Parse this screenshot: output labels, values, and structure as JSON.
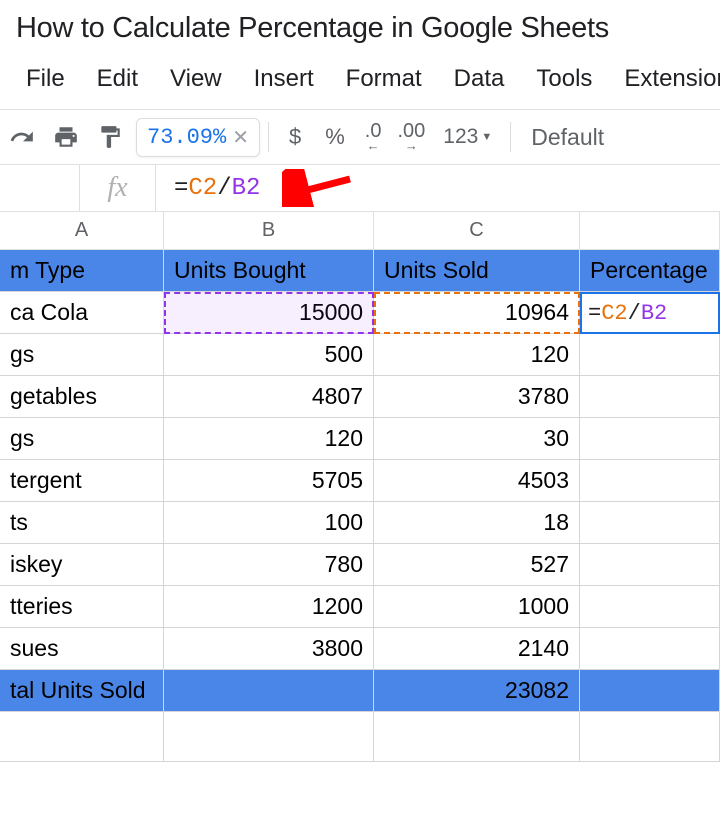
{
  "title": "How to Calculate Percentage in Google Sheets",
  "menu": {
    "file": "File",
    "edit": "Edit",
    "view": "View",
    "insert": "Insert",
    "format": "Format",
    "data": "Data",
    "tools": "Tools",
    "extensions": "Extensions"
  },
  "toolbar": {
    "result_preview": "73.09%",
    "currency": "$",
    "percent": "%",
    "dec_decrease": ".0",
    "dec_increase": ".00",
    "more_formats": "123",
    "font": "Default"
  },
  "formula_bar": {
    "fx": "fx",
    "eq": "=",
    "ref1": "C2",
    "slash": "/",
    "ref2": "B2"
  },
  "columns": {
    "A": "A",
    "B": "B",
    "C": "C"
  },
  "headers": {
    "item_type": "m Type",
    "units_bought": "Units Bought",
    "units_sold": "Units Sold",
    "percentage": "Percentage"
  },
  "rows": [
    {
      "name": "ca Cola",
      "bought": "15000",
      "sold": "10964"
    },
    {
      "name": "gs",
      "bought": "500",
      "sold": "120"
    },
    {
      "name": "getables",
      "bought": "4807",
      "sold": "3780"
    },
    {
      "name": "gs",
      "bought": "120",
      "sold": "30"
    },
    {
      "name": "tergent",
      "bought": "5705",
      "sold": "4503"
    },
    {
      "name": "ts",
      "bought": "100",
      "sold": "18"
    },
    {
      "name": "iskey",
      "bought": "780",
      "sold": "527"
    },
    {
      "name": "tteries",
      "bought": "1200",
      "sold": "1000"
    },
    {
      "name": "sues",
      "bought": "3800",
      "sold": "2140"
    }
  ],
  "total": {
    "label": "tal Units Sold",
    "sold": "23082"
  },
  "active_cell": {
    "eq": "=",
    "ref1": "C2",
    "slash": "/",
    "ref2": "B2"
  },
  "chart_data": {
    "type": "table",
    "columns": [
      "Item Type",
      "Units Bought",
      "Units Sold",
      "Percentage"
    ],
    "rows": [
      [
        "Coca Cola",
        15000,
        10964,
        null
      ],
      [
        "Eggs",
        500,
        120,
        null
      ],
      [
        "Vegetables",
        4807,
        3780,
        null
      ],
      [
        "Eggs",
        120,
        30,
        null
      ],
      [
        "Detergent",
        5705,
        4503,
        null
      ],
      [
        "Hats",
        100,
        18,
        null
      ],
      [
        "Whiskey",
        780,
        527,
        null
      ],
      [
        "Batteries",
        1200,
        1000,
        null
      ],
      [
        "Tissues",
        3800,
        2140,
        null
      ]
    ],
    "totals": {
      "label": "Total Units Sold",
      "sold": 23082
    },
    "formula": "=C2/B2",
    "formula_result": "73.09%"
  }
}
